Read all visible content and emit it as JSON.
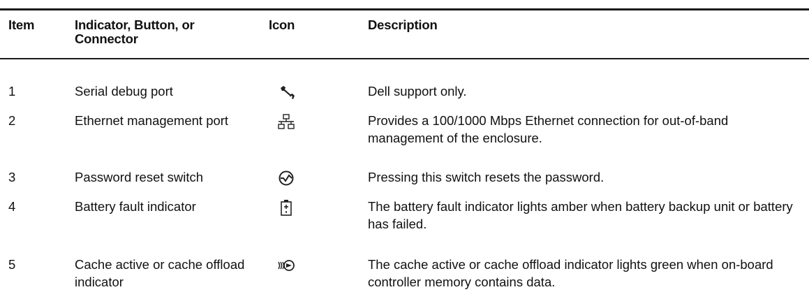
{
  "table": {
    "headers": {
      "item": "Item",
      "name": "Indicator, Button, or Connector",
      "icon": "Icon",
      "description": "Description"
    },
    "rows": [
      {
        "item": "1",
        "name": "Serial debug port",
        "icon": "wrench-icon",
        "description": "Dell support only."
      },
      {
        "item": "2",
        "name": "Ethernet management port",
        "icon": "network-icon",
        "description": "Provides a 100/1000 Mbps Ethernet connection for out-of-band management of the enclosure."
      },
      {
        "item": "3",
        "name": "Password reset switch",
        "icon": "reset-switch-icon",
        "description": "Pressing this switch resets the password."
      },
      {
        "item": "4",
        "name": "Battery fault indicator",
        "icon": "battery-icon",
        "description": "The battery fault indicator lights amber when battery backup unit or battery has failed."
      },
      {
        "item": "5",
        "name": "Cache active or cache offload indicator",
        "icon": "cache-offload-icon",
        "description": "The cache active or cache offload indicator lights green when on-board controller memory contains data."
      }
    ]
  }
}
